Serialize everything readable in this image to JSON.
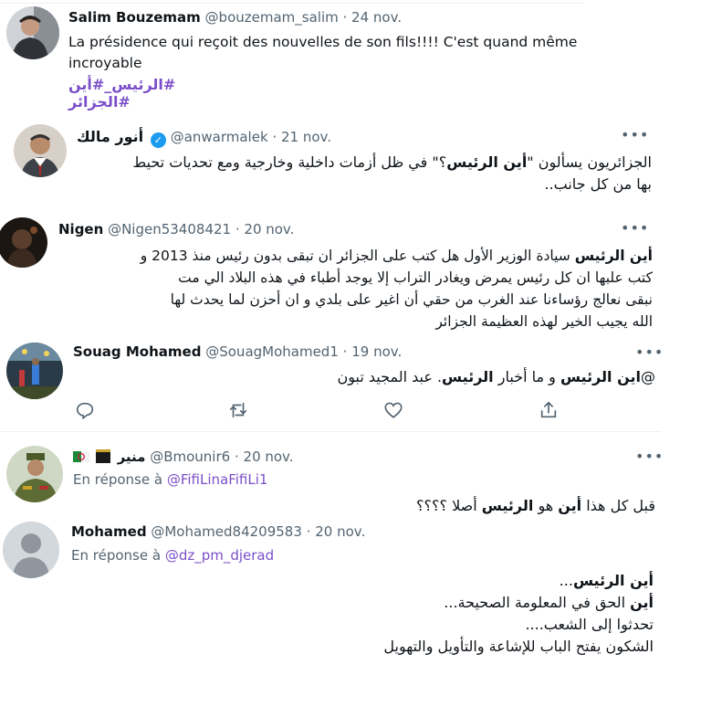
{
  "tweets": [
    {
      "name": "Salim Bouzemam",
      "handle": "@bouzemam_salim",
      "date": "· 24 nov.",
      "text_line1": "La présidence qui reçoit des nouvelles de son fils!!!! C'est quand même",
      "text_line2": "incroyable",
      "hashtags": "#الرئيس_#أين #الجزائر",
      "avatar_icon": "person-photo"
    },
    {
      "name": "أنور مالك",
      "handle": "@anwarmalek",
      "date": "· 21 nov.",
      "verified_icon": "verified-badge-icon",
      "text_pre": "الجزائريون يسألون \"",
      "text_bold": "أين الرئيس",
      "text_post": "؟\" في ظل أزمات داخلية وخارجية ومع تحديات تحيط",
      "text_line2": "بها من كل جانب..",
      "more": "•••"
    },
    {
      "name": "Nigen",
      "handle": "@Nigen53408421",
      "date": "· 20 nov.",
      "text_bold": "أين الرئيس",
      "text_line1": " سيادة الوزير الأول  هل كتب على الجزائر ان تبقى بدون رئيس منذ 2013 و",
      "text_line2": "كتب علبها ان كل رئيس يمرض ويغادر التراب  إلا يوجد أطباء في هذه البلاد الي مت",
      "text_line3": "نبقى نعالج رؤساءنا عند الغرب من حقي أن اغير على بلدي و ان أحزن لما يحدث لها",
      "text_line4": "الله يجيب الخير لهذه العظيمة الجزائر",
      "more": "•••"
    },
    {
      "name": "Souag Mohamed",
      "handle": "@SouagMohamed1",
      "date": "· 19 nov.",
      "text_prefix": "@",
      "text_bold1": "اين الرئيس",
      "text_mid": " و ما أخبار ",
      "text_bold2": "الرئيس",
      "text_post": ".  عبد المجيد تبون",
      "more": "•••",
      "actions": [
        "reply-icon",
        "retweet-icon",
        "like-icon",
        "share-icon"
      ]
    },
    {
      "name": "منير",
      "handle": "@Bmounir6",
      "date": "· 20 nov.",
      "reply_prefix": "En réponse à",
      "reply_to": "@FifiLinaFifiLi1",
      "text_pre": "قبل كل هذا ",
      "text_bold1": "أين",
      "text_mid": " هو ",
      "text_bold2": "الرئيس",
      "text_post": " أصلا ؟؟؟؟",
      "more": "•••"
    },
    {
      "name": "Mohamed",
      "handle": "@Mohamed84209583",
      "date": "· 20 nov.",
      "reply_prefix": "En réponse à",
      "reply_to": "@dz_pm_djerad",
      "line1_bold": "أين الرئيس",
      "line1_post": "...",
      "line2_bold": "أين",
      "line2_post": " الحق في المعلومة الصحيحة...",
      "line3": "تحدثوا إلى الشعب....",
      "line4": "الشكون يفتح الباب للإشاعة والتأويل والتهويل"
    }
  ],
  "colors": {
    "accent": "#7b4fc9",
    "muted": "#536471",
    "verified": "#1d9bf0"
  }
}
